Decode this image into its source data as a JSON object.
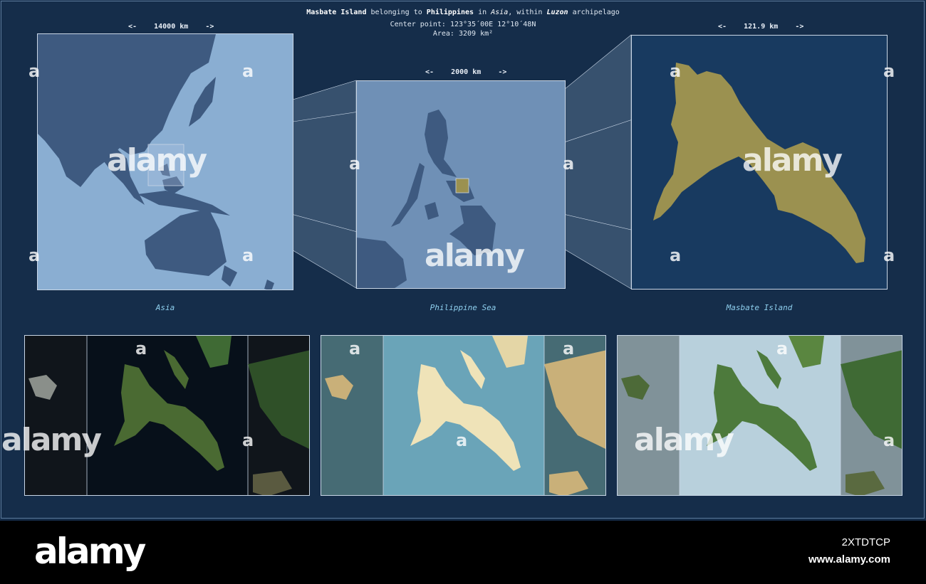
{
  "header": {
    "island_name": "Masbate Island",
    "belonging_text": "belonging to",
    "country": "Philippines",
    "in_text": "in",
    "continent": "Asia",
    "within_text": ", within",
    "archipelago": "Luzon",
    "archipelago_word": "archipelago",
    "center_point_label": "Center point:",
    "center_point_value": "123°35´00E  12°10´48N",
    "area_label": "Area:",
    "area_value": "3209 km²"
  },
  "scales": {
    "asia": "<-    14000 km    ->",
    "sea": "<-    2000 km    ->",
    "island": "<-    121.9 km    ->"
  },
  "captions": {
    "asia": "Asia",
    "sea": "Philippine Sea",
    "island": "Masbate Island"
  },
  "watermark": {
    "text": "alamy",
    "letter": "a"
  },
  "footer": {
    "logo": "alamy",
    "image_code": "2XTDTCP",
    "url": "www.alamy.com"
  },
  "colors": {
    "background": "#152d4a",
    "ocean_light": "#8aaed2",
    "land_dark": "#3e5a80",
    "island_fill": "#9b9150",
    "caption": "#8fd0ef"
  }
}
